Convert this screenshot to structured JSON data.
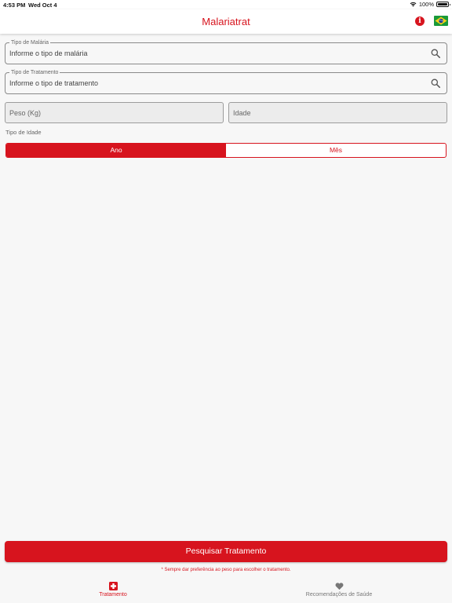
{
  "status_bar": {
    "time": "4:53 PM",
    "date": "Wed Oct 4",
    "battery": "100%"
  },
  "header": {
    "title": "Malariatrat",
    "info_icon": "info-icon",
    "flag_icon": "brazil-flag-icon"
  },
  "form": {
    "malaria_type": {
      "legend": "Tipo de Malária",
      "value": "Informe o tipo de malária"
    },
    "treatment_type": {
      "legend": "Tipo de Tratamento",
      "value": "Informe o tipo de tratamento"
    },
    "weight": {
      "placeholder": "Peso (Kg)"
    },
    "age": {
      "placeholder": "Idade"
    },
    "age_type_label": "Tipo de Idade",
    "age_type_options": [
      "Ano",
      "Mês"
    ],
    "age_type_selected": "Ano"
  },
  "actions": {
    "search_label": "Pesquisar Tratamento",
    "footnote": "* Sempre dar preferência ao peso para escolher o tratamento."
  },
  "tabs": [
    {
      "label": "Tratamento",
      "icon": "medical-cross-icon",
      "active": true
    },
    {
      "label": "Recomendações de Saúde",
      "icon": "heart-icon",
      "active": false
    }
  ],
  "colors": {
    "accent": "#d7141e",
    "background": "#f7f7f7"
  }
}
